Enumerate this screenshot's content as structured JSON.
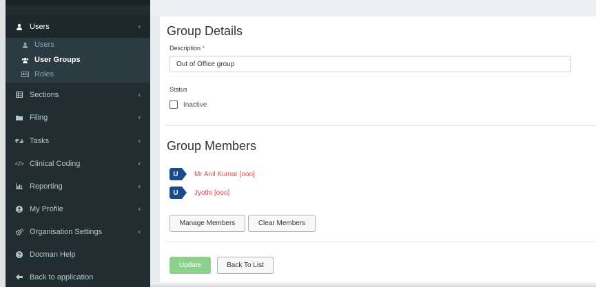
{
  "sidebar": {
    "items": [
      {
        "label": "Users",
        "icon": "user-icon",
        "expandable": true,
        "active": true,
        "children": [
          {
            "label": "Users",
            "icon": "user-icon"
          },
          {
            "label": "User Groups",
            "icon": "users-icon",
            "current": true
          },
          {
            "label": "Roles",
            "icon": "id-card-icon"
          }
        ]
      },
      {
        "label": "Sections",
        "icon": "table-icon",
        "expandable": true
      },
      {
        "label": "Filing",
        "icon": "folder-icon",
        "expandable": true
      },
      {
        "label": "Tasks",
        "icon": "retweet-icon",
        "expandable": true
      },
      {
        "label": "Clinical Coding",
        "icon": "code-icon",
        "expandable": true
      },
      {
        "label": "Reporting",
        "icon": "bar-chart-icon",
        "expandable": true
      },
      {
        "label": "My Profile",
        "icon": "user-circle-icon",
        "expandable": true
      },
      {
        "label": "Organisation Settings",
        "icon": "cogs-icon",
        "expandable": true
      },
      {
        "label": "Docman Help",
        "icon": "question-circle-icon",
        "expandable": false
      },
      {
        "label": "Back to application",
        "icon": "arrow-left-icon",
        "expandable": false
      }
    ]
  },
  "group_details": {
    "title": "Group Details",
    "description_label": "Description",
    "required_mark": "*",
    "description_value": "Out of Office group",
    "status_label": "Status",
    "inactive_label": "Inactive",
    "inactive_checked": false
  },
  "group_members": {
    "title": "Group Members",
    "members": [
      {
        "badge": "U",
        "name": "Mr Anil Kumar [ooo]"
      },
      {
        "badge": "U",
        "name": "Jyothi [ooo]"
      }
    ],
    "manage_label": "Manage Members",
    "clear_label": "Clear Members"
  },
  "actions": {
    "update_label": "Update",
    "back_label": "Back To List"
  },
  "colors": {
    "sidebar_bg": "#222d32",
    "submenu_bg": "#2c3b41",
    "badge_blue": "#1c4b8c",
    "member_link": "#e0474c",
    "update_green": "#8dd08d"
  }
}
